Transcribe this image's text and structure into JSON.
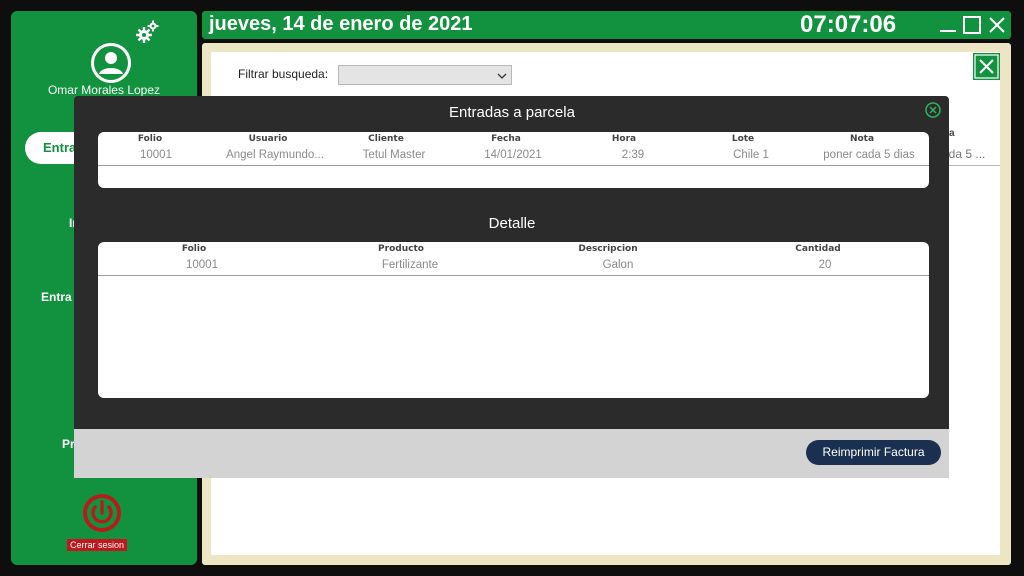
{
  "sidebar": {
    "username": "Omar Morales Lopez",
    "nav": [
      {
        "label": "Entra"
      },
      {
        "label": "In"
      },
      {
        "label": "Entra"
      },
      {
        "label": "Pr"
      }
    ],
    "logout_label": "Cerrar sesion"
  },
  "header": {
    "date": "jueves, 14 de enero de 2021",
    "time": "07:07:06"
  },
  "main": {
    "filter_label": "Filtrar busqueda:",
    "filter_value": "",
    "bg_fragments": [
      "a",
      "ada 5 ..."
    ]
  },
  "modal": {
    "title": "Entradas a parcela",
    "entries": {
      "columns": [
        "Folio",
        "Usuario",
        "Cliente",
        "Fecha",
        "Hora",
        "Lote",
        "Nota"
      ],
      "rows": [
        [
          "10001",
          "Angel Raymundo...",
          "Tetul Master",
          "14/01/2021",
          "2:39",
          "Chile 1",
          "poner cada 5 dias"
        ]
      ]
    },
    "detail_title": "Detalle",
    "detail": {
      "columns": [
        "Folio",
        "Producto",
        "Descripcion",
        "Cantidad"
      ],
      "rows": [
        [
          "10001",
          "Fertilizante",
          "Galon",
          "20"
        ]
      ]
    },
    "reprint_label": "Reimprimir Factura"
  },
  "colors": {
    "brand_green": "#12923e",
    "modal_bg": "#2b2b2b",
    "button_navy": "#1b3050",
    "logout_red": "#c0181e",
    "frame_beige": "#ece6c4"
  },
  "icons": [
    "user-avatar-icon",
    "gears-icon",
    "power-icon",
    "minimize-icon",
    "maximize-icon",
    "close-icon",
    "chevron-down-icon",
    "circle-close-icon"
  ]
}
